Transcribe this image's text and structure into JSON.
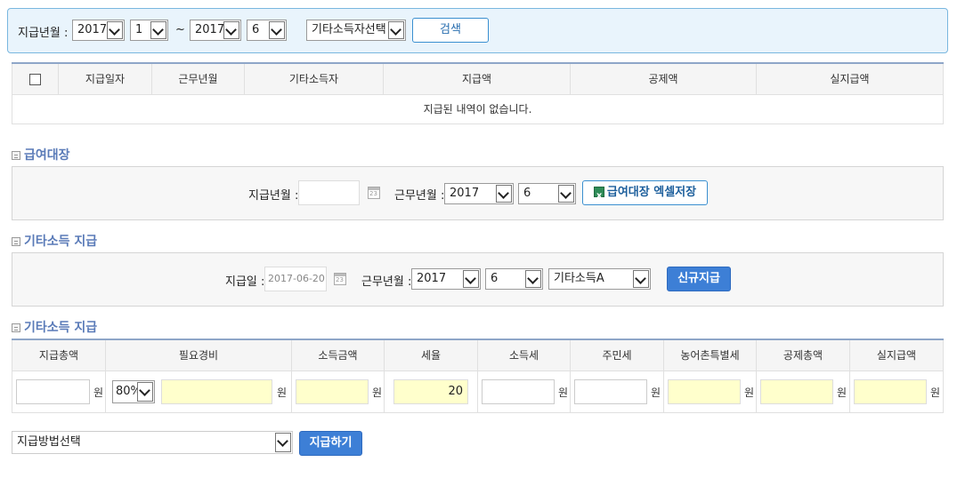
{
  "search": {
    "label": "지급년월 :",
    "from_year": "2017",
    "from_month": "1",
    "tilde": "~",
    "to_year": "2017",
    "to_month": "6",
    "earner_select": "기타소득자선택",
    "search_button": "검색"
  },
  "list": {
    "columns": [
      "지급일자",
      "근무년월",
      "기타소득자",
      "지급액",
      "공제액",
      "실지급액"
    ],
    "empty_message": "지급된 내역이 없습니다."
  },
  "payroll": {
    "title": "급여대장",
    "pay_month_label": "지급년월 :",
    "work_month_label": "근무년월 :",
    "work_year": "2017",
    "work_month": "6",
    "excel_button": "급여대장 엑셀저장"
  },
  "other_income": {
    "title": "기타소득 지급",
    "pay_date_label": "지급일 :",
    "pay_date_value": "2017-06-20",
    "work_month_label": "근무년월 :",
    "work_year": "2017",
    "work_month": "6",
    "earner": "기타소득A",
    "new_button": "신규지급"
  },
  "pay_detail": {
    "title": "기타소득 지급",
    "columns": [
      "지급총액",
      "필요경비",
      "소득금액",
      "세율",
      "소득세",
      "주민세",
      "농어촌특별세",
      "공제총액",
      "실지급액"
    ],
    "unit": "원",
    "expense_rate": "80%",
    "tax_rate": "20"
  },
  "footer": {
    "method_select": "지급방법선택",
    "pay_button": "지급하기"
  }
}
